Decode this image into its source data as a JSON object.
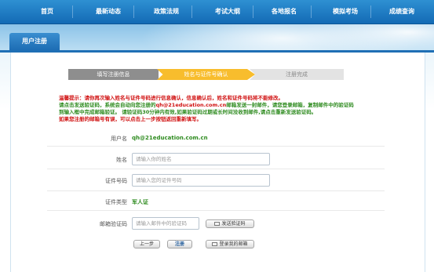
{
  "nav": {
    "items": [
      "首页",
      "最新动态",
      "政策法规",
      "考试大纲",
      "各地报名",
      "模拟考场",
      "成绩查询"
    ]
  },
  "banner": {
    "tab": "用户注册"
  },
  "steps": [
    "填写注册信息",
    "姓名与证件号确认",
    "注册完成"
  ],
  "tip": {
    "line1": "温馨提示：请你再次输入姓名与证件号码进行信息确认，信息确认后，姓名和证件号码将不能修改。",
    "line2_a": "请点击发送验证码，系统会自动向您注册的",
    "line2_email": "qh@21education.com.cn",
    "line2_b": "邮箱发送一封邮件，请您登录邮箱，复制邮件中的验证码",
    "line3": "到输入框中完成邮箱验证。 请验证码30分钟内有效,如果验证码过期或长时间没收到邮件,请点击重新发送验证码。",
    "line4": "如果您注册的邮箱号有误，可以点击上一步按钮返回重新填写。"
  },
  "form": {
    "username_label": "用户名",
    "username_value": "qh@21education.com.cn",
    "name_label": "姓名",
    "name_placeholder": "请输入你的姓名",
    "id_label": "证件号码",
    "id_placeholder": "请输入您的证件号码",
    "idtype_label": "证件类型",
    "idtype_value": "军人证",
    "code_label": "邮箱验证码",
    "code_placeholder": "请输入邮件中的验证码",
    "send_code": "发送验证码"
  },
  "buttons": {
    "prev": "上一步",
    "register": "注册",
    "login_mail": "登录我的邮箱"
  },
  "colors": {
    "nav": "#1f78c4",
    "step_active": "#f8bd2d",
    "tip_green": "#2e8b1f",
    "tip_red": "#d01010"
  }
}
